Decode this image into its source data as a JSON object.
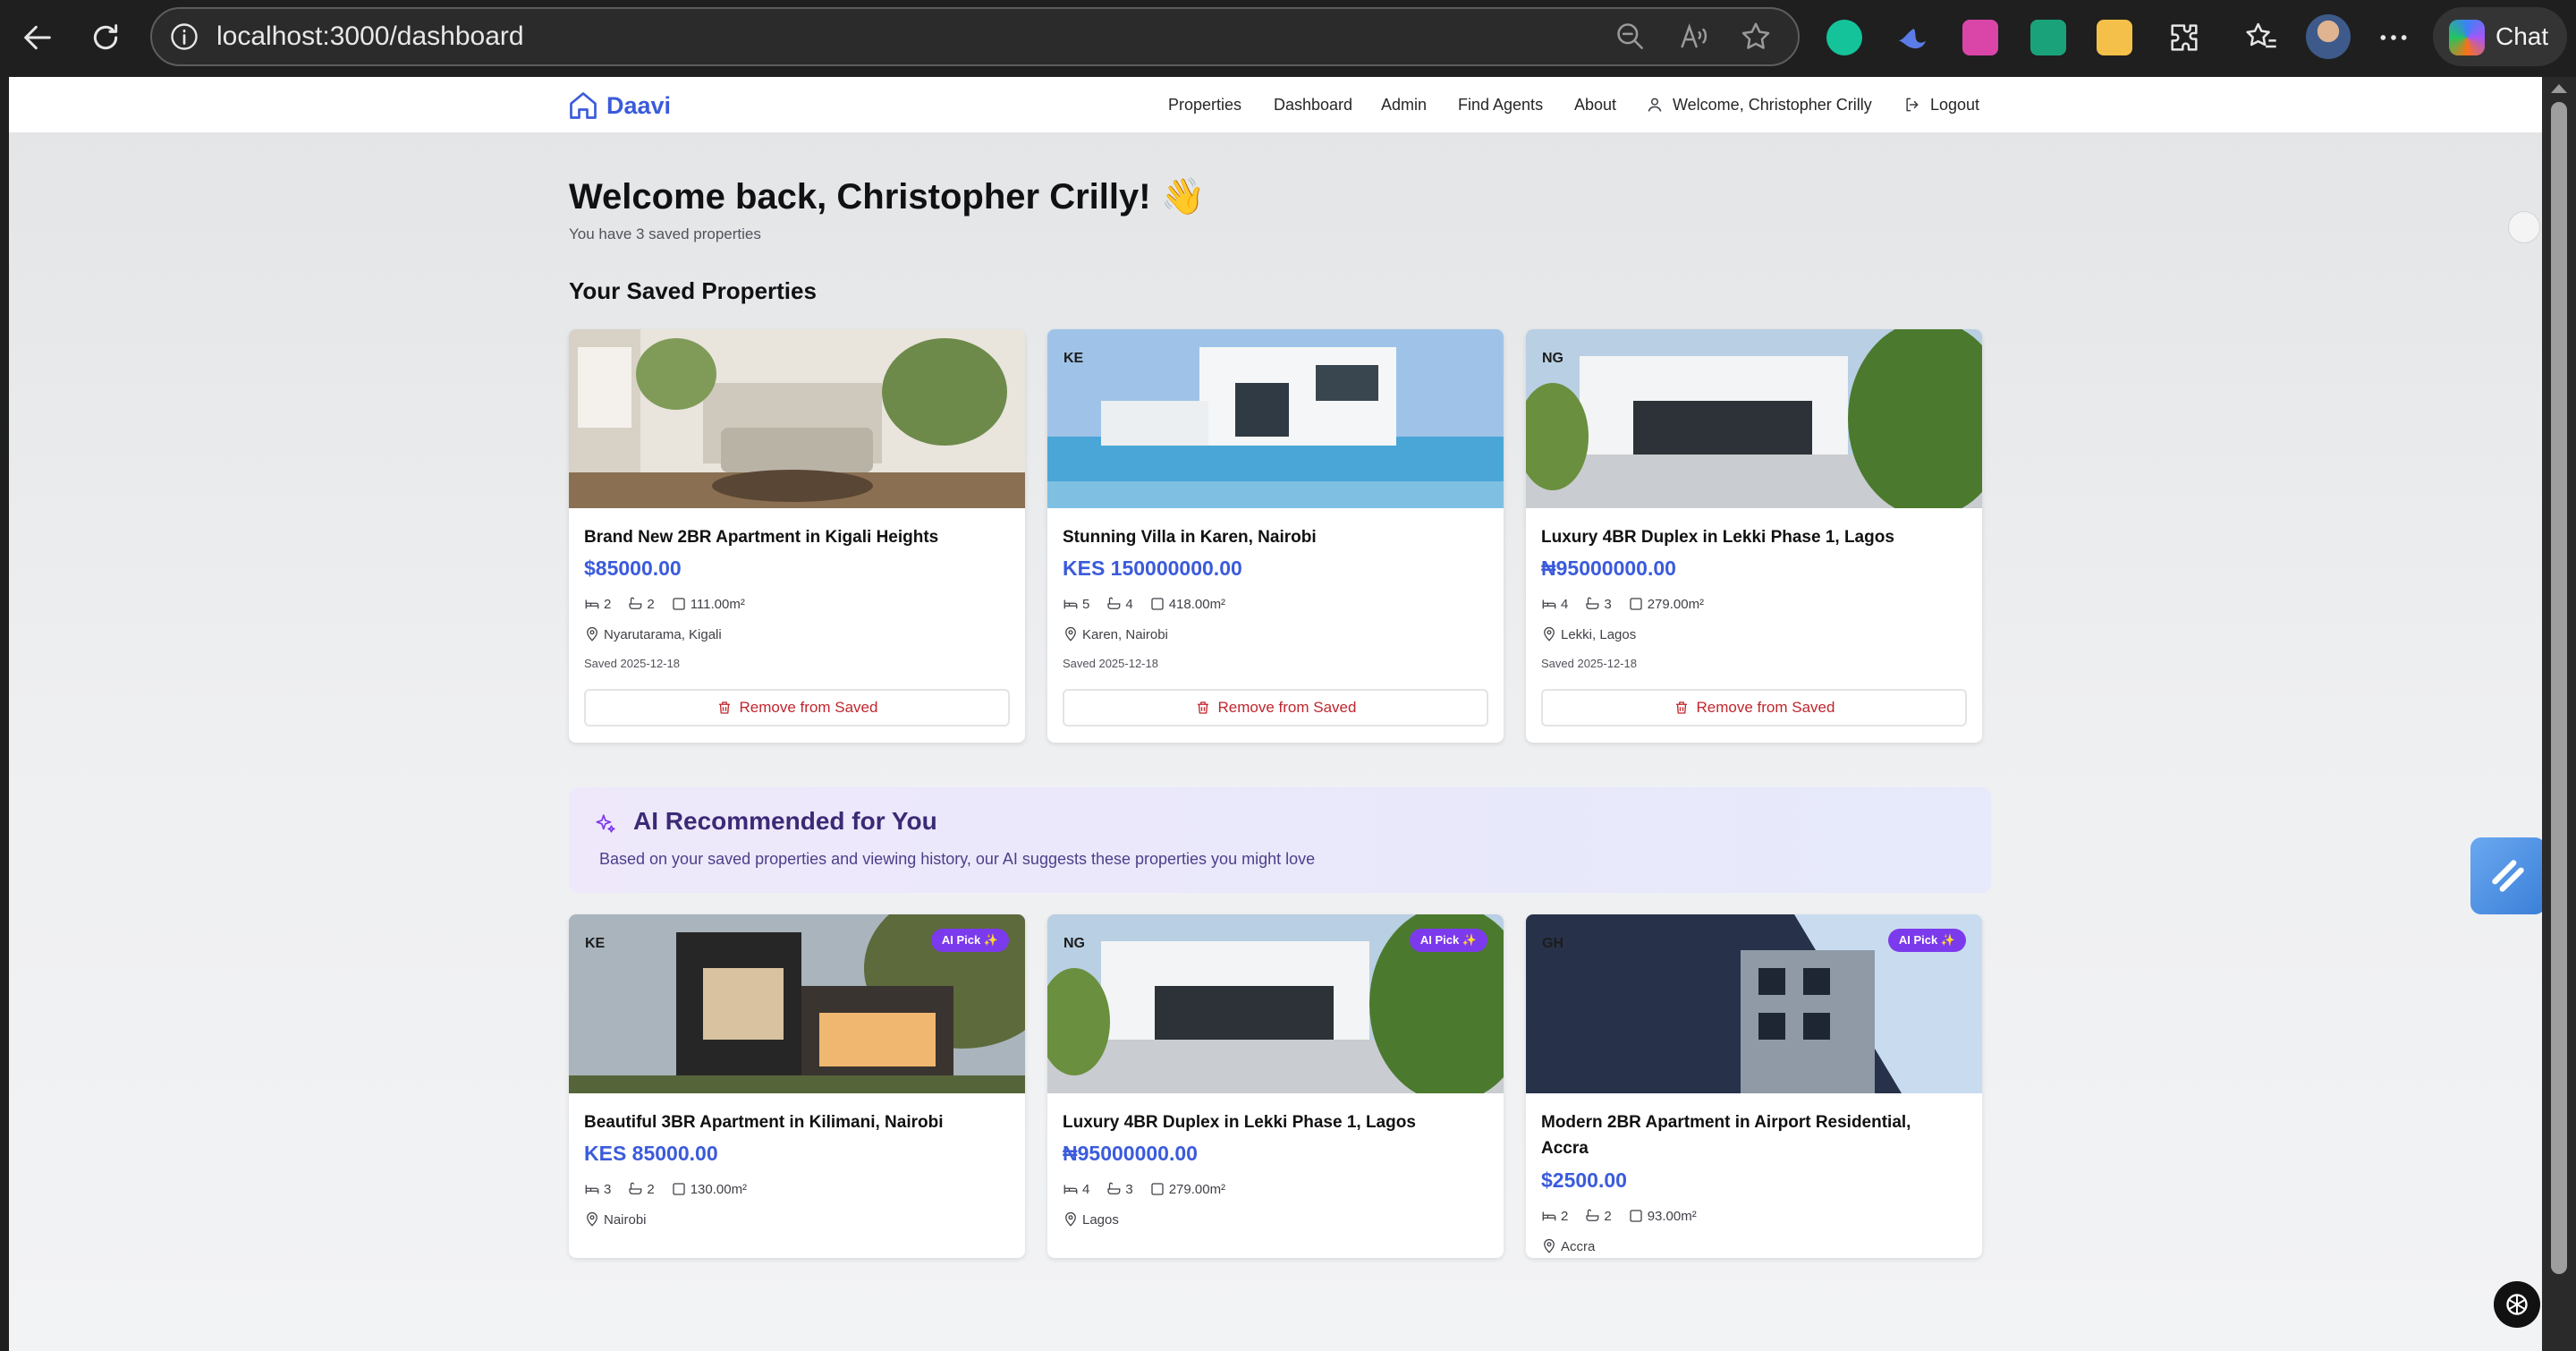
{
  "browser": {
    "url": "localhost:3000/dashboard",
    "chat_label": "Chat"
  },
  "nav": {
    "brand": "Daavi",
    "items": [
      "Properties",
      "Dashboard",
      "Admin",
      "Find Agents",
      "About"
    ],
    "welcome": "Welcome, Christopher Crilly",
    "logout": "Logout"
  },
  "page": {
    "title": "Welcome back, Christopher Crilly! 👋",
    "subtitle": "You have 3 saved properties",
    "saved_heading": "Your Saved Properties"
  },
  "saved": [
    {
      "code": "",
      "name": "Brand New 2BR Apartment in Kigali Heights",
      "price": "$85000.00",
      "beds": "2",
      "baths": "2",
      "area": "111.00m²",
      "location": "Nyarutarama, Kigali",
      "saved": "Saved 2025-12-18",
      "remove": "Remove from Saved"
    },
    {
      "code": "KE",
      "name": "Stunning Villa in Karen, Nairobi",
      "price": "KES 150000000.00",
      "beds": "5",
      "baths": "4",
      "area": "418.00m²",
      "location": "Karen, Nairobi",
      "saved": "Saved 2025-12-18",
      "remove": "Remove from Saved"
    },
    {
      "code": "NG",
      "name": "Luxury 4BR Duplex in Lekki Phase 1, Lagos",
      "price": "₦95000000.00",
      "beds": "4",
      "baths": "3",
      "area": "279.00m²",
      "location": "Lekki, Lagos",
      "saved": "Saved 2025-12-18",
      "remove": "Remove from Saved"
    }
  ],
  "ai": {
    "title": "AI Recommended for You",
    "description": "Based on your saved properties and viewing history, our AI suggests these properties you might love",
    "badge": "AI Pick ✨"
  },
  "recommended": [
    {
      "code": "KE",
      "name": "Beautiful 3BR Apartment in Kilimani, Nairobi",
      "price": "KES 85000.00",
      "beds": "3",
      "baths": "2",
      "area": "130.00m²",
      "location": "Nairobi"
    },
    {
      "code": "NG",
      "name": "Luxury 4BR Duplex in Lekki Phase 1, Lagos",
      "price": "₦95000000.00",
      "beds": "4",
      "baths": "3",
      "area": "279.00m²",
      "location": "Lagos"
    },
    {
      "code": "GH",
      "name": "Modern 2BR Apartment in Airport Residential, Accra",
      "price": "$2500.00",
      "beds": "2",
      "baths": "2",
      "area": "93.00m²",
      "location": "Accra"
    }
  ],
  "colors": {
    "brand": "#3b5bdb",
    "danger": "#c0262d",
    "ai_accent": "#7c3aed"
  }
}
